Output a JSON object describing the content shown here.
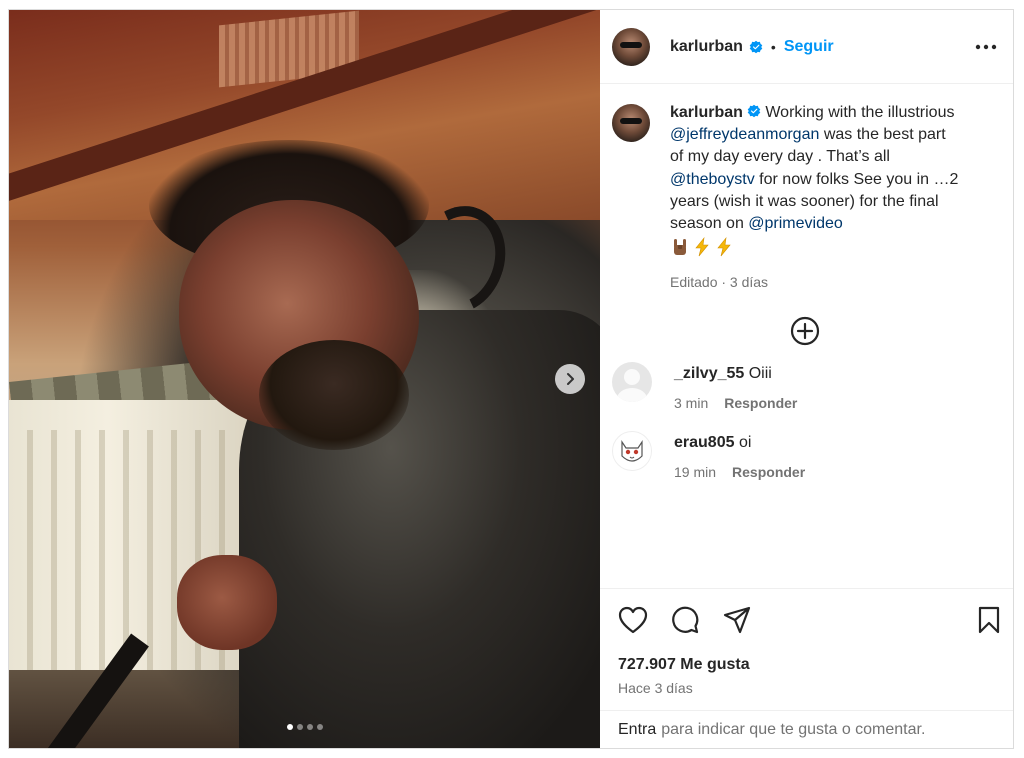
{
  "post": {
    "username": "karlurban",
    "follow_label": "Seguir",
    "separator": "•",
    "verified": true
  },
  "caption": {
    "username": "karlurban",
    "text_1": " Working with the illustrious ",
    "mention_1": "@jeffreydeanmorgan",
    "text_2": " was the best part of my day every day . That’s all ",
    "mention_2": "@theboystv",
    "text_3": " for now folks See you in …2 years (wish it was sooner) for the final season on ",
    "mention_3": "@primevideo",
    "emojis": [
      "rock-hand-emoji",
      "lightning-emoji",
      "lightning-emoji"
    ],
    "meta": "Editado · 3 días"
  },
  "comments": [
    {
      "username": "_zilvy_55",
      "text": "Oiii",
      "time": "3 min",
      "reply_label": "Responder"
    },
    {
      "username": "erau805",
      "text": "oi",
      "time": "19 min",
      "reply_label": "Responder"
    }
  ],
  "stats": {
    "likes": "727.907 Me gusta",
    "time_ago": "Hace 3 días"
  },
  "footer": {
    "login": "Entra",
    "prompt": "para indicar que te gusta o comentar."
  },
  "carousel": {
    "total_slides": 4,
    "active_slide": 1
  },
  "colors": {
    "accent": "#0095f6",
    "mention": "#00376b",
    "text": "#262626",
    "muted": "#737373",
    "verified": "#0095f6"
  },
  "icons": [
    "more-icon",
    "add-comment-icon",
    "heart-icon",
    "comment-icon",
    "share-icon",
    "save-icon",
    "chevron-right-icon",
    "verified-icon"
  ]
}
